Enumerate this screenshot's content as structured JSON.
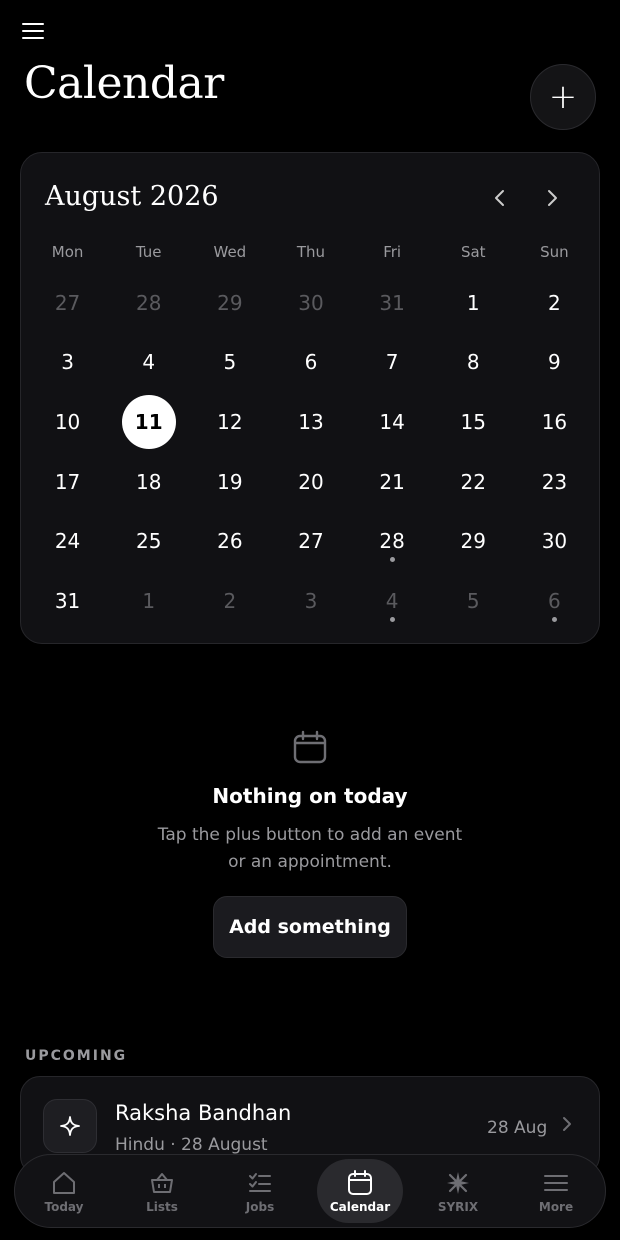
{
  "header": {
    "title": "Calendar",
    "add_icon": "plus-icon",
    "menu_icon": "hamburger-icon"
  },
  "calendar": {
    "month_label": "August 2026",
    "prev_icon": "chevron-left-icon",
    "next_icon": "chevron-right-icon",
    "weekdays": [
      "Mon",
      "Tue",
      "Wed",
      "Thu",
      "Fri",
      "Sat",
      "Sun"
    ],
    "days": [
      {
        "n": "27",
        "muted": true
      },
      {
        "n": "28",
        "muted": true
      },
      {
        "n": "29",
        "muted": true
      },
      {
        "n": "30",
        "muted": true
      },
      {
        "n": "31",
        "muted": true
      },
      {
        "n": "1"
      },
      {
        "n": "2"
      },
      {
        "n": "3"
      },
      {
        "n": "4"
      },
      {
        "n": "5"
      },
      {
        "n": "6"
      },
      {
        "n": "7"
      },
      {
        "n": "8"
      },
      {
        "n": "9"
      },
      {
        "n": "10"
      },
      {
        "n": "11",
        "today": true
      },
      {
        "n": "12"
      },
      {
        "n": "13"
      },
      {
        "n": "14"
      },
      {
        "n": "15"
      },
      {
        "n": "16"
      },
      {
        "n": "17"
      },
      {
        "n": "18"
      },
      {
        "n": "19"
      },
      {
        "n": "20"
      },
      {
        "n": "21"
      },
      {
        "n": "22"
      },
      {
        "n": "23"
      },
      {
        "n": "24"
      },
      {
        "n": "25"
      },
      {
        "n": "26"
      },
      {
        "n": "27"
      },
      {
        "n": "28",
        "event": true
      },
      {
        "n": "29"
      },
      {
        "n": "30"
      },
      {
        "n": "31"
      },
      {
        "n": "1",
        "muted": true
      },
      {
        "n": "2",
        "muted": true
      },
      {
        "n": "3",
        "muted": true
      },
      {
        "n": "4",
        "muted": true,
        "event": true
      },
      {
        "n": "5",
        "muted": true
      },
      {
        "n": "6",
        "muted": true,
        "event": true
      }
    ]
  },
  "empty_state": {
    "icon": "calendar-icon",
    "title": "Nothing on today",
    "subtitle": "Tap the plus button to add an event or an appointment.",
    "button_label": "Add something"
  },
  "upcoming": {
    "section_label": "UPCOMING",
    "items": [
      {
        "icon": "sparkle-icon",
        "title": "Raksha Bandhan",
        "subtitle": "Hindu · 28 August",
        "date": "28 Aug"
      }
    ]
  },
  "tabs": [
    {
      "id": "today",
      "label": "Today",
      "icon": "home-icon",
      "active": false
    },
    {
      "id": "lists",
      "label": "Lists",
      "icon": "basket-icon",
      "active": false
    },
    {
      "id": "jobs",
      "label": "Jobs",
      "icon": "checklist-icon",
      "active": false
    },
    {
      "id": "calendar",
      "label": "Calendar",
      "icon": "calendar-icon",
      "active": true
    },
    {
      "id": "syrix",
      "label": "SYRIX",
      "icon": "syrix-logo-icon",
      "active": false
    },
    {
      "id": "more",
      "label": "More",
      "icon": "menu-icon",
      "active": false
    }
  ],
  "colors": {
    "background": "#000000",
    "card": "#111114",
    "muted_text": "#9a9a9e",
    "today_fill": "#ffffff"
  }
}
